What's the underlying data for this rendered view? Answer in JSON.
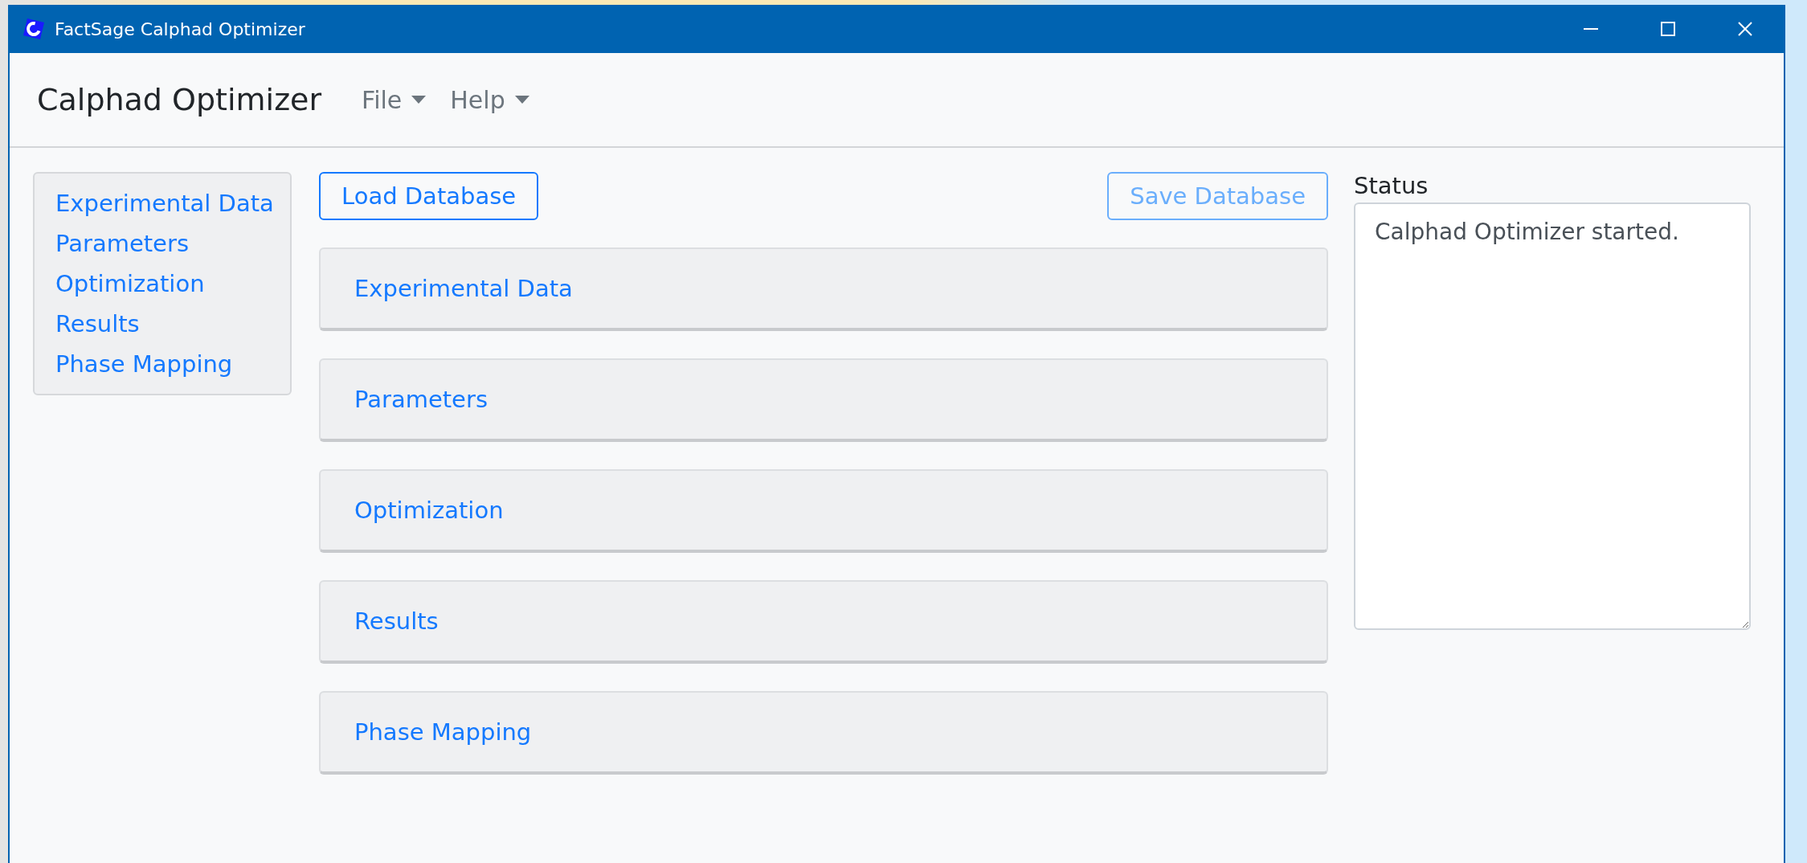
{
  "window": {
    "title": "FactSage Calphad Optimizer"
  },
  "navbar": {
    "brand": "Calphad Optimizer",
    "menus": [
      {
        "label": "File"
      },
      {
        "label": "Help"
      }
    ]
  },
  "sidebar": {
    "items": [
      {
        "label": "Experimental Data"
      },
      {
        "label": "Parameters"
      },
      {
        "label": "Optimization"
      },
      {
        "label": "Results"
      },
      {
        "label": "Phase Mapping"
      }
    ]
  },
  "toolbar": {
    "buttons": [
      {
        "label": "Load Database",
        "disabled": false
      },
      {
        "label": "Save Database",
        "disabled": true
      }
    ]
  },
  "sections": [
    {
      "title": "Experimental Data"
    },
    {
      "title": "Parameters"
    },
    {
      "title": "Optimization"
    },
    {
      "title": "Results"
    },
    {
      "title": "Phase Mapping"
    }
  ],
  "status": {
    "label": "Status",
    "value": "Calphad Optimizer started."
  }
}
